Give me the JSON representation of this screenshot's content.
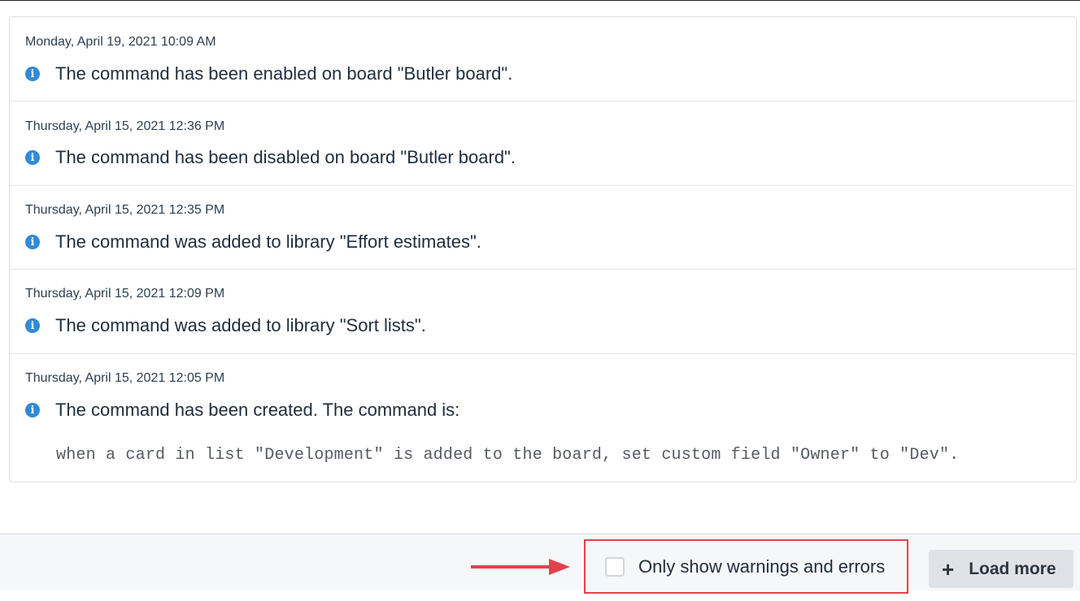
{
  "log_entries": [
    {
      "timestamp": "Monday, April 19, 2021 10:09 AM",
      "message": "The command has been enabled on board \"Butler board\"."
    },
    {
      "timestamp": "Thursday, April 15, 2021 12:36 PM",
      "message": "The command has been disabled on board \"Butler board\"."
    },
    {
      "timestamp": "Thursday, April 15, 2021 12:35 PM",
      "message": "The command was added to library \"Effort estimates\"."
    },
    {
      "timestamp": "Thursday, April 15, 2021 12:09 PM",
      "message": "The command was added to library \"Sort lists\"."
    },
    {
      "timestamp": "Thursday, April 15, 2021 12:05 PM",
      "message": "The command has been created. The command is:",
      "code": "when a card in list \"Development\" is added to the board, set custom field \"Owner\" to \"Dev\"."
    }
  ],
  "icons": {
    "entry_icon": "info-icon",
    "load_more_icon": "plus-icon",
    "annotation": "arrow-icon"
  },
  "filter": {
    "label": "Only show warnings and errors",
    "checked": false
  },
  "load_more": {
    "label": "Load more"
  },
  "colors": {
    "info": "#2f8ad8",
    "highlight": "#e4414b"
  }
}
